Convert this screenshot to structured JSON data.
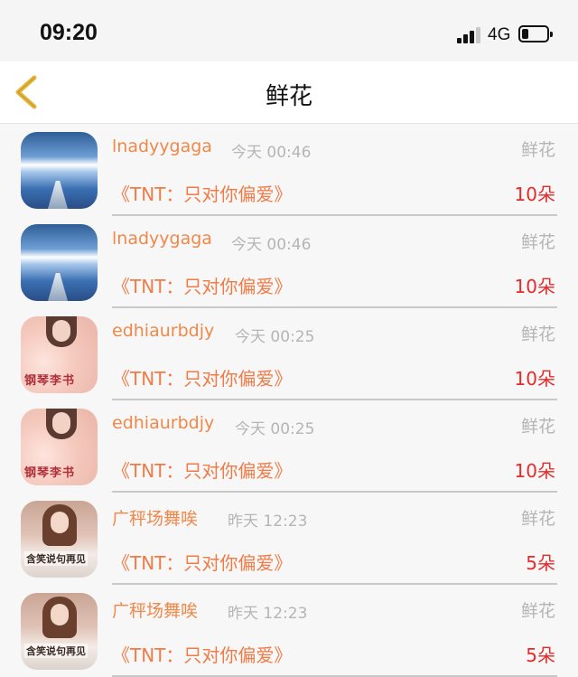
{
  "status_bar": {
    "time": "09:20",
    "network": "4G"
  },
  "nav": {
    "title": "鲜花"
  },
  "items": [
    {
      "avatar": "sky-pier-avatar",
      "user": "lnadyygaga",
      "time": "今天 00:46",
      "gift": "鲜花",
      "song": "《TNT：只对你偏爱》",
      "count": "10朵"
    },
    {
      "avatar": "sky-pier-avatar",
      "user": "lnadyygaga",
      "time": "今天 00:46",
      "gift": "鲜花",
      "song": "《TNT：只对你偏爱》",
      "count": "10朵"
    },
    {
      "avatar": "flower-girl-avatar",
      "user": "edhiaurbdjy",
      "time": "今天 00:25",
      "gift": "鲜花",
      "song": "《TNT：只对你偏爱》",
      "count": "10朵",
      "avatar_caption": "钢琴李书"
    },
    {
      "avatar": "flower-girl-avatar",
      "user": "edhiaurbdjy",
      "time": "今天 00:25",
      "gift": "鲜花",
      "song": "《TNT：只对你偏爱》",
      "count": "10朵",
      "avatar_caption": "钢琴李书"
    },
    {
      "avatar": "smiling-girl-avatar",
      "user": "广秤场舞唉",
      "time": "昨天 12:23",
      "gift": "鲜花",
      "song": "《TNT：只对你偏爱》",
      "count": "5朵",
      "avatar_caption": "含笑说句再见"
    },
    {
      "avatar": "smiling-girl-avatar",
      "user": "广秤场舞唉",
      "time": "昨天 12:23",
      "gift": "鲜花",
      "song": "《TNT：只对你偏爱》",
      "count": "5朵",
      "avatar_caption": "含笑说句再见"
    }
  ],
  "colors": {
    "username": "#f0884a",
    "song": "#ef7b46",
    "count": "#e62a2a",
    "muted": "#b5b5b5",
    "back_arrow": "#e6b53a"
  }
}
